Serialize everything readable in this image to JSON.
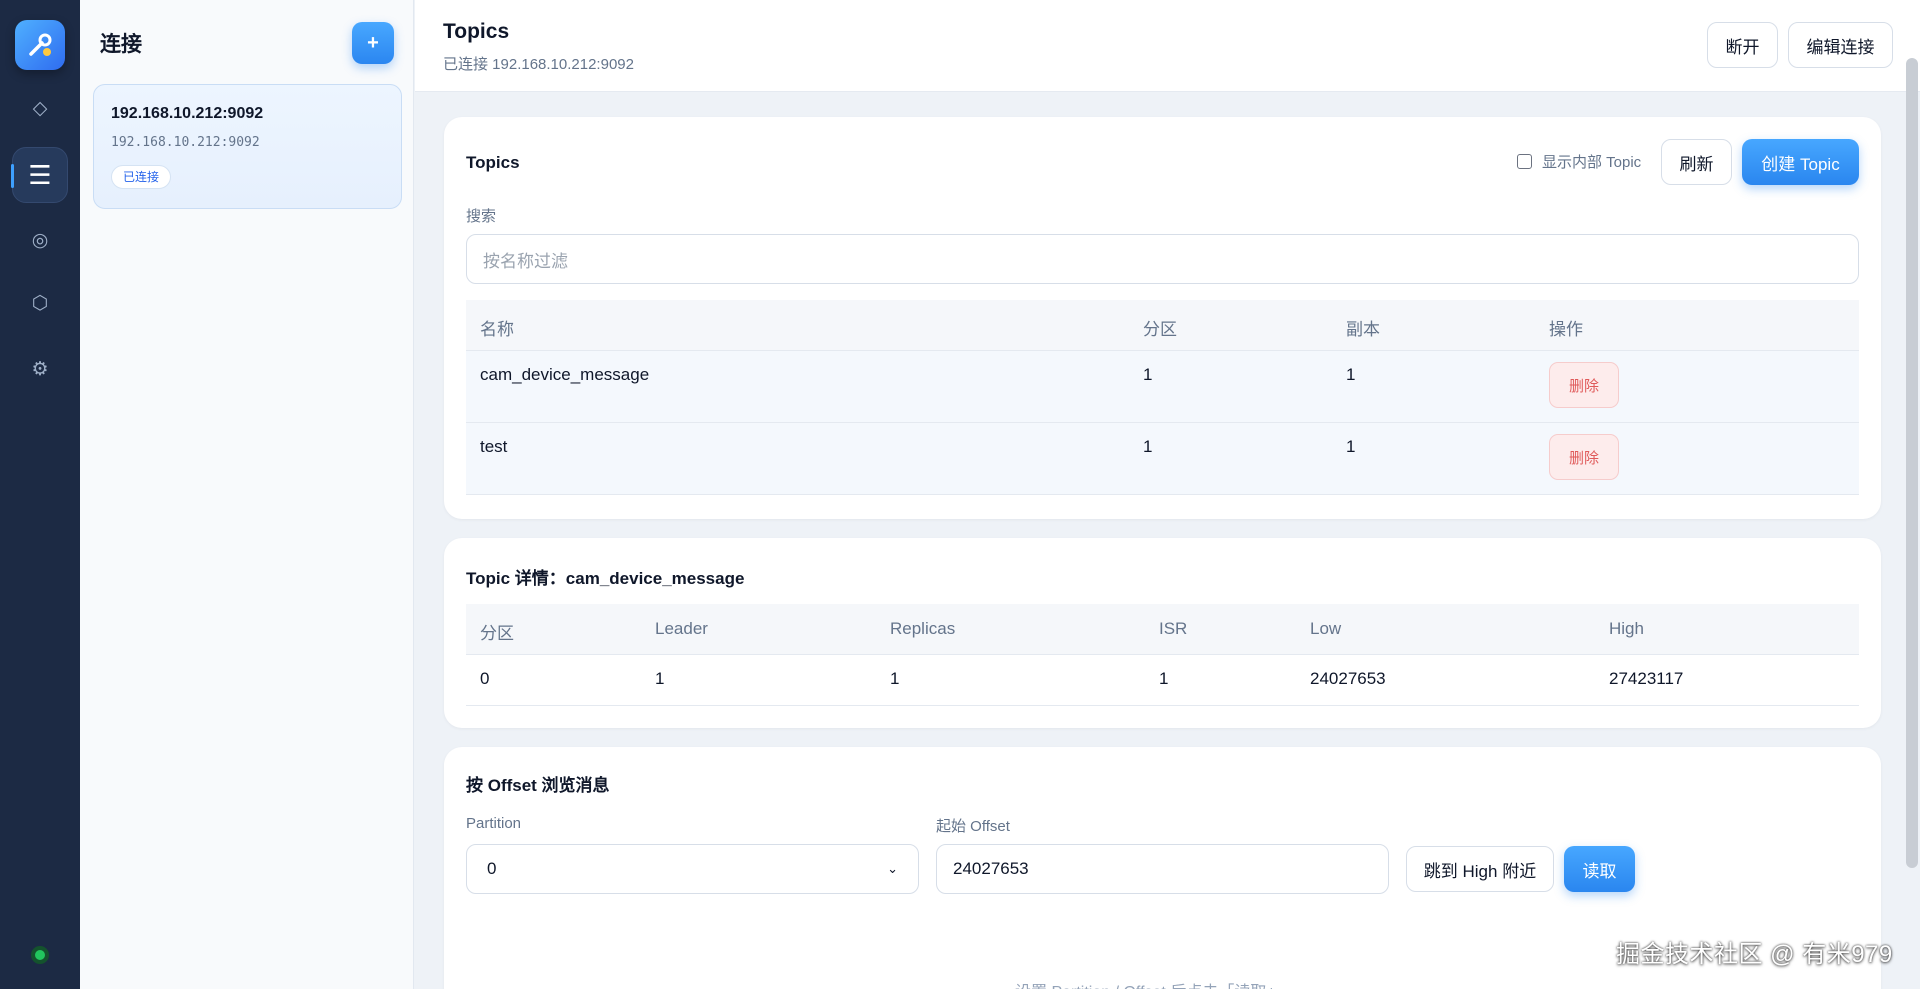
{
  "rail": {
    "logo_icon": "tools-wrench-icon",
    "items": [
      {
        "name": "diamond-icon",
        "glyph": "◇",
        "active": false
      },
      {
        "name": "list-icon",
        "glyph": "☰",
        "active": true
      },
      {
        "name": "target-icon",
        "glyph": "◎",
        "active": false
      },
      {
        "name": "hexagon-icon",
        "glyph": "⬡",
        "active": false
      },
      {
        "name": "gear-icon",
        "glyph": "⚙",
        "active": false
      }
    ],
    "status_color": "#22c55e"
  },
  "connections": {
    "title": "连接",
    "add_label": "+",
    "items": [
      {
        "name": "192.168.10.212:9092",
        "address": "192.168.10.212:9092",
        "status": "已连接"
      }
    ]
  },
  "header": {
    "title": "Topics",
    "subtitle": "已连接 192.168.10.212:9092",
    "disconnect_label": "断开",
    "edit_label": "编辑连接"
  },
  "topics": {
    "title": "Topics",
    "show_internal_label": "显示内部 Topic",
    "refresh_label": "刷新",
    "create_label": "创建 Topic",
    "search_label": "搜索",
    "search_placeholder": "按名称过滤",
    "columns": [
      "名称",
      "分区",
      "副本",
      "操作"
    ],
    "rows": [
      {
        "name": "cam_device_message",
        "partitions": "1",
        "replicas": "1",
        "action": "删除"
      },
      {
        "name": "test",
        "partitions": "1",
        "replicas": "1",
        "action": "删除"
      }
    ]
  },
  "detail": {
    "title": "Topic 详情：cam_device_message",
    "columns": [
      "分区",
      "Leader",
      "Replicas",
      "ISR",
      "Low",
      "High"
    ],
    "rows": [
      [
        "0",
        "1",
        "1",
        "1",
        "24027653",
        "27423117"
      ]
    ]
  },
  "browse": {
    "title": "按 Offset 浏览消息",
    "partition_label": "Partition",
    "partition_value": "0",
    "offset_label": "起始 Offset",
    "offset_value": "24027653",
    "jump_label": "跳到 High 附近",
    "read_label": "读取",
    "hint": "设置 Partition / Offset 后点击「读取」"
  },
  "watermark": "掘金技术社区 @ 有米979",
  "accent_color": "#2a86ef"
}
